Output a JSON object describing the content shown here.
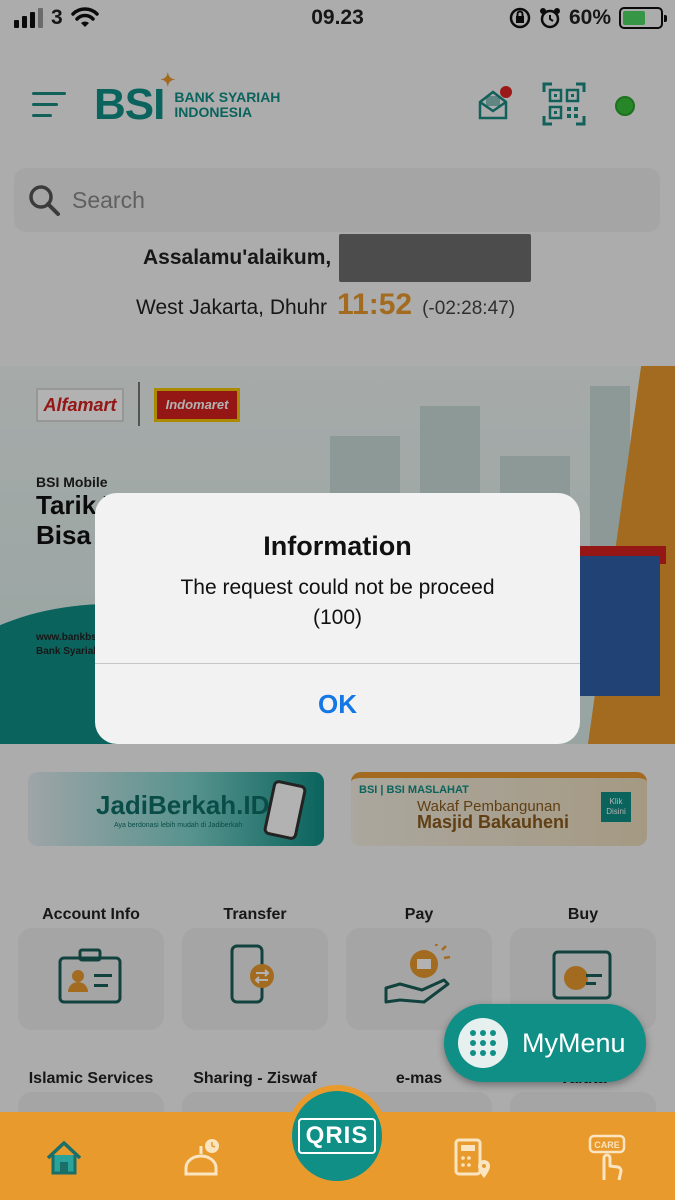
{
  "status_bar": {
    "carrier": "3",
    "time": "09.23",
    "battery": "60%",
    "battery_level": 0.6,
    "icons": [
      "signal-icon",
      "wifi-icon",
      "orientation-lock-icon",
      "alarm-icon",
      "battery-icon"
    ]
  },
  "header": {
    "logo_mark": "BSI",
    "logo_line1": "BANK SYARIAH",
    "logo_line2": "INDONESIA",
    "icons": [
      "hamburger-menu-icon",
      "mail-icon",
      "qr-code-icon",
      "online-status-dot"
    ],
    "online_color": "#37c03a"
  },
  "search": {
    "placeholder": "Search"
  },
  "greeting": {
    "salutation": "Assalamu'alaikum,",
    "location_prayer": "West Jakarta, Dhuhr",
    "prayer_time": "11:52",
    "countdown": "(-02:28:47)"
  },
  "banner": {
    "brand_1": "Alfamart",
    "brand_2": "Indomaret",
    "subtitle": "BSI Mobile",
    "headline_1": "Tarik T",
    "headline_2": "Bisa d",
    "footer_1": "www.bankbsi",
    "footer_2": "Bank Syariah"
  },
  "dialog": {
    "title": "Information",
    "message_1": "The request could not be proceed",
    "message_2": "(100)",
    "ok_label": "OK"
  },
  "promos": [
    {
      "title": "JadiBerkah.ID",
      "subtitle": "Aya berdonasi lebih mudah di Jadiberkah"
    },
    {
      "top": "BSI | BSI MASLAHAT",
      "line1": "Wakaf Pembangunan",
      "line2": "Masjid Bakauheni",
      "badge": "Klik Disini"
    }
  ],
  "menu": {
    "row1": [
      "Account Info",
      "Transfer",
      "Pay",
      "Buy"
    ],
    "row2": [
      "Islamic Services",
      "Sharing - Ziswaf",
      "e-mas",
      "Valuta"
    ]
  },
  "fab": {
    "label": "MyMenu"
  },
  "bottom_nav": {
    "items": [
      "home-icon",
      "mosque-clock-icon",
      "qris-button",
      "calculator-location-icon",
      "care-icon"
    ],
    "qris_label": "QRIS",
    "care_label": "CARE"
  },
  "colors": {
    "brand_teal": "#0f8f86",
    "brand_orange": "#e89a2d",
    "link_blue": "#1477e6"
  }
}
